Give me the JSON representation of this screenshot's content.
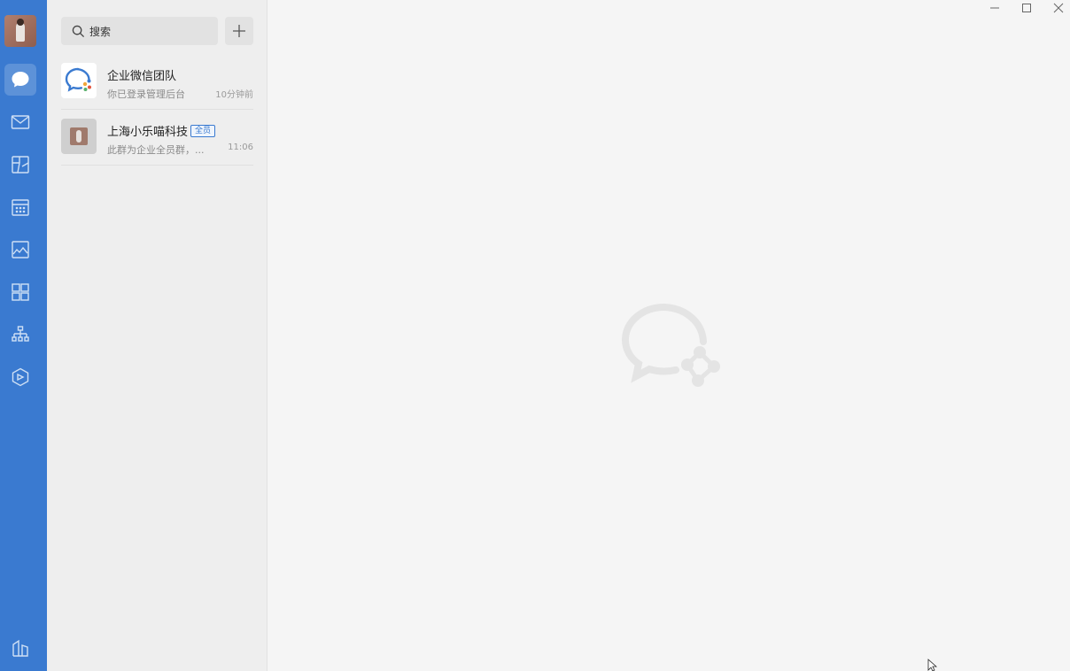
{
  "search": {
    "placeholder": "搜索"
  },
  "conversations": [
    {
      "title": "企业微信团队",
      "preview": "你已登录管理后台",
      "time": "10分钟前",
      "badge": ""
    },
    {
      "title": "上海小乐喵科技",
      "preview": "此群为企业全员群，...",
      "time": "11:06",
      "badge": "全员"
    }
  ],
  "icons": {
    "rail": [
      "chat-icon",
      "mail-icon",
      "docs-icon",
      "calendar-icon",
      "photo-icon",
      "apps-icon",
      "org-chart-icon",
      "cube-icon",
      "building-icon"
    ],
    "search": "search-icon",
    "add": "plus-icon",
    "window": [
      "minimize-icon",
      "maximize-icon",
      "close-icon"
    ]
  },
  "colors": {
    "accent": "#3a7ad0",
    "rail": "#3a7ad0",
    "listBg": "#eeeeee",
    "mainBg": "#f5f5f5"
  }
}
